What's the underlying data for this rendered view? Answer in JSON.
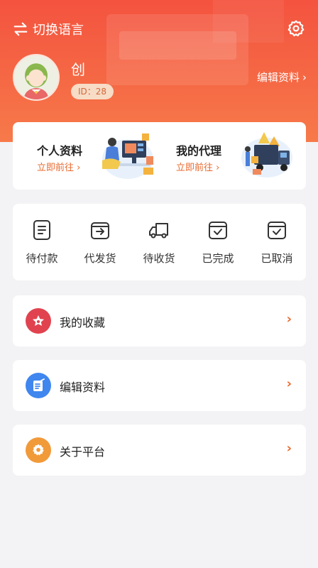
{
  "header": {
    "lang_switch_label": "切换语言",
    "settings_icon": "gear-icon",
    "switch_icon": "swap-arrows-icon"
  },
  "profile": {
    "username": "创",
    "uid_label": "ID：28",
    "edit_link": "编辑资料",
    "avatar_icon": "user-avatar"
  },
  "quick_links": [
    {
      "title": "个人资料",
      "action": "立即前往",
      "illustration": "office-worker-illustration"
    },
    {
      "title": "我的代理",
      "action": "立即前往",
      "illustration": "delivery-truck-illustration"
    }
  ],
  "orders": [
    {
      "label": "待付款",
      "icon": "document-icon"
    },
    {
      "label": "代发货",
      "icon": "outbox-icon"
    },
    {
      "label": "待收货",
      "icon": "truck-icon"
    },
    {
      "label": "已完成",
      "icon": "box-check-icon"
    },
    {
      "label": "已取消",
      "icon": "box-check-icon"
    }
  ],
  "menu": [
    {
      "label": "我的收藏",
      "icon": "star-icon",
      "color": "#e0434f"
    },
    {
      "label": "编辑资料",
      "icon": "edit-icon",
      "color": "#3f86ef"
    },
    {
      "label": "关于平台",
      "icon": "settings-icon",
      "color": "#f19a3a"
    }
  ],
  "colors": {
    "brand": "#f4533f",
    "accent": "#e8692e",
    "background": "#f3f3f5"
  }
}
